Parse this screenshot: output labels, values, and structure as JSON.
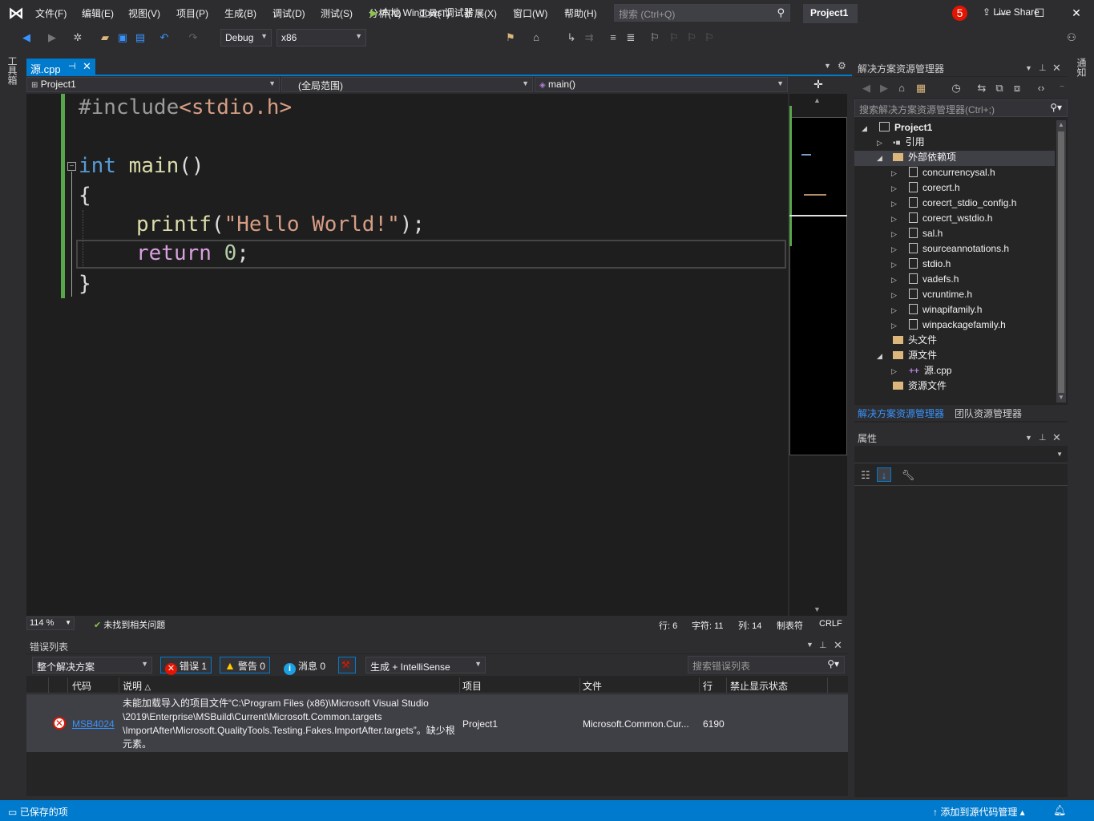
{
  "menu": {
    "items": [
      "文件(F)",
      "编辑(E)",
      "视图(V)",
      "项目(P)",
      "生成(B)",
      "调试(D)",
      "测试(S)",
      "分析(N)",
      "工具(T)",
      "扩展(X)",
      "窗口(W)",
      "帮助(H)"
    ],
    "search_placeholder": "搜索 (Ctrl+Q)",
    "project_title": "Project1",
    "notification_count": "5"
  },
  "toolbar": {
    "config": "Debug",
    "platform": "x86",
    "run_label": "本地 Windows 调试器",
    "live_share": "Live Share"
  },
  "side_tabs": {
    "left": "工具箱",
    "right": "通知"
  },
  "editor": {
    "tab_name": "源.cpp",
    "nav_project": "Project1",
    "nav_scope": "(全局范围)",
    "nav_member": "main()",
    "code": {
      "l1_pre": "#include",
      "l1_file": "<stdio.h>",
      "l3_type": "int",
      "l3_fn": " main",
      "l3_paren": "()",
      "l4": "{",
      "l5_fn": "printf",
      "l5_open": "(",
      "l5_str": "\"Hello World!\"",
      "l5_close": ");",
      "l6_kw": "return",
      "l6_num": " 0",
      "l6_semi": ";",
      "l7": "}"
    },
    "zoom": "114 %",
    "issues": "未找到相关问题",
    "row": "行: 6",
    "char": "字符: 11",
    "col": "列: 14",
    "tab_mode": "制表符",
    "eol": "CRLF"
  },
  "error_list": {
    "title": "错误列表",
    "scope": "整个解决方案",
    "errors": "错误 1",
    "warnings": "警告 0",
    "messages": "消息 0",
    "build_filter": "生成 + IntelliSense",
    "search_placeholder": "搜索错误列表",
    "columns": [
      "代码",
      "说明",
      "项目",
      "文件",
      "行",
      "禁止显示状态"
    ],
    "rows": [
      {
        "code": "MSB4024",
        "description": "未能加载导入的项目文件“C:\\Program Files (x86)\\Microsoft Visual Studio \\2019\\Enterprise\\MSBuild\\Current\\Microsoft.Common.targets \\ImportAfter\\Microsoft.QualityTools.Testing.Fakes.ImportAfter.targets”。缺少根元素。",
        "project": "Project1",
        "file": "Microsoft.Common.Cur...",
        "line": "6190",
        "suppression": ""
      }
    ]
  },
  "solution_explorer": {
    "title": "解决方案资源管理器",
    "search_placeholder": "搜索解决方案资源管理器(Ctrl+;)",
    "tree": {
      "project": "Project1",
      "references": "引用",
      "external": "外部依赖项",
      "headers": [
        "concurrencysal.h",
        "corecrt.h",
        "corecrt_stdio_config.h",
        "corecrt_wstdio.h",
        "sal.h",
        "sourceannotations.h",
        "stdio.h",
        "vadefs.h",
        "vcruntime.h",
        "winapifamily.h",
        "winpackagefamily.h"
      ],
      "header_files": "头文件",
      "source_files": "源文件",
      "source_cpp": "源.cpp",
      "resource_files": "资源文件"
    },
    "tab_active": "解决方案资源管理器",
    "tab_team": "团队资源管理器"
  },
  "properties": {
    "title": "属性"
  },
  "statusbar": {
    "left": "已保存的项",
    "right": "↑  添加到源代码管理 ▴"
  },
  "colors": {
    "accent": "#007acc",
    "error": "#e51400",
    "change_bar": "#57a64a"
  }
}
